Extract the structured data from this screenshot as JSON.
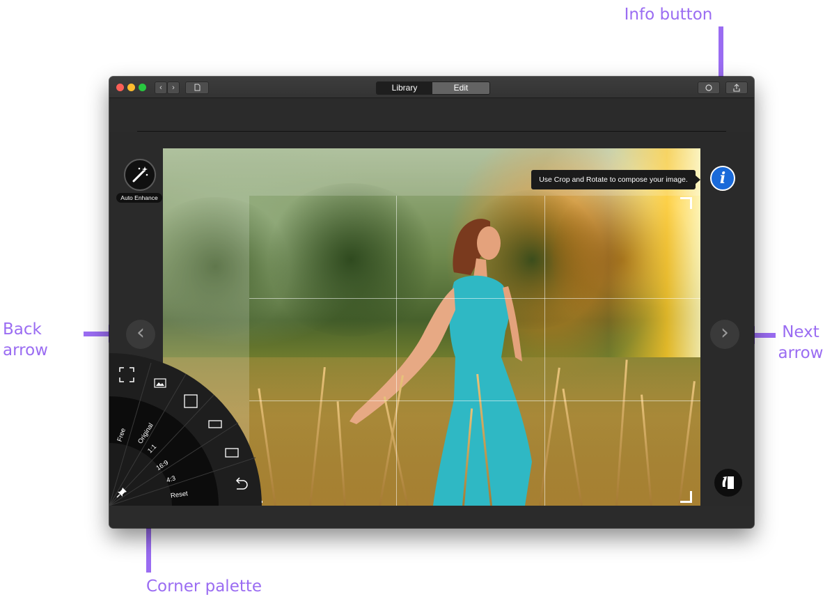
{
  "callouts": {
    "info": "Info button",
    "back_line1": "Back",
    "back_line2": "arrow",
    "next_line1": "Next",
    "next_line2": "arrow",
    "palette": "Corner palette"
  },
  "window": {
    "tabs": {
      "library": "Library",
      "edit": "Edit"
    }
  },
  "editor": {
    "tooltip": "Use Crop and Rotate to compose your image.",
    "info_glyph": "i",
    "auto_enhance_label": "Auto Enhance",
    "back_glyph": "‹",
    "next_glyph": "›"
  },
  "palette": {
    "ratios": [
      "Free",
      "Original",
      "1:1",
      "16:9",
      "4:3",
      "Reset"
    ],
    "icons": [
      "fullscreen-crop-icon",
      "image-icon",
      "square-icon",
      "landscape-rect-icon",
      "rect-icon",
      "undo-icon",
      "pin-icon"
    ]
  },
  "colors": {
    "accent": "#9a6cf2",
    "info_blue": "#1a6ad9",
    "window_bg": "#2a2a2a"
  }
}
